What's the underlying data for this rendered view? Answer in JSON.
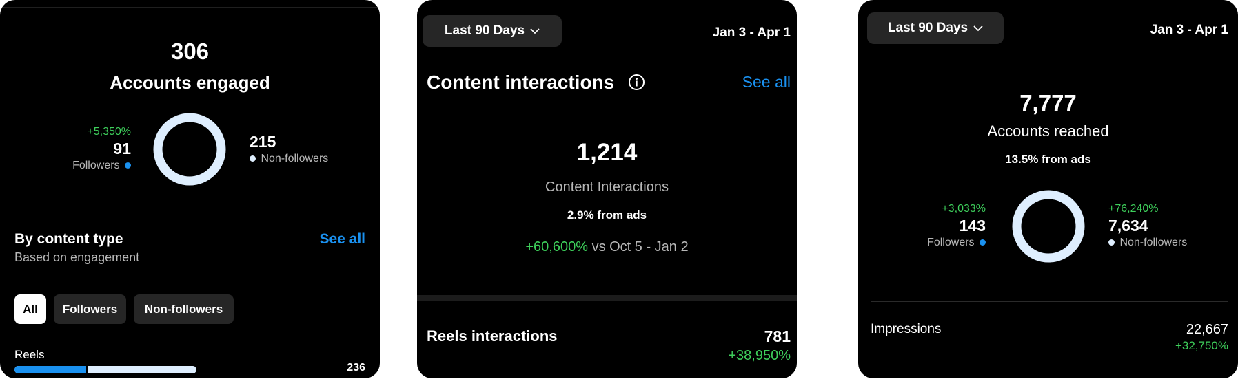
{
  "engaged_panel": {
    "total": "306",
    "title": "Accounts engaged",
    "followers_change": "+5,350%",
    "followers_count": "91",
    "followers_label": "Followers",
    "nonfollowers_count": "215",
    "nonfollowers_label": "Non-followers",
    "followers_fraction": 0.297,
    "section_title": "By content type",
    "section_subtitle": "Based on engagement",
    "see_all": "See all",
    "filters": [
      "All",
      "Followers",
      "Non-followers"
    ],
    "bar_label": "Reels",
    "bar_value": "236",
    "bar_followers_fraction": 0.4
  },
  "interactions_panel": {
    "date_range_label": "Last 90 Days",
    "date_range": "Jan 3 - Apr 1",
    "title": "Content interactions",
    "see_all": "See all",
    "total": "1,214",
    "total_label": "Content Interactions",
    "ads_note": "2.9% from ads",
    "change": "+60,600%",
    "comparison": "vs Oct 5 - Jan 2",
    "reels_label": "Reels interactions",
    "reels_value": "781",
    "reels_change": "+38,950%"
  },
  "reach_panel": {
    "date_range_label": "Last 90 Days",
    "date_range": "Jan 3 - Apr 1",
    "total": "7,777",
    "total_label": "Accounts reached",
    "ads_note": "13.5% from ads",
    "followers_change": "+3,033%",
    "followers_count": "143",
    "followers_label": "Followers",
    "nonfollowers_change": "+76,240%",
    "nonfollowers_count": "7,634",
    "nonfollowers_label": "Non-followers",
    "followers_fraction": 0.018,
    "impressions_label": "Impressions",
    "impressions_value": "22,667",
    "impressions_change": "+32,750%"
  },
  "colors": {
    "followers": "#1a91f0",
    "non_followers": "#deeefe",
    "positive": "#3ecf5b",
    "link": "#1a91f0",
    "panel_bg": "#000000"
  }
}
